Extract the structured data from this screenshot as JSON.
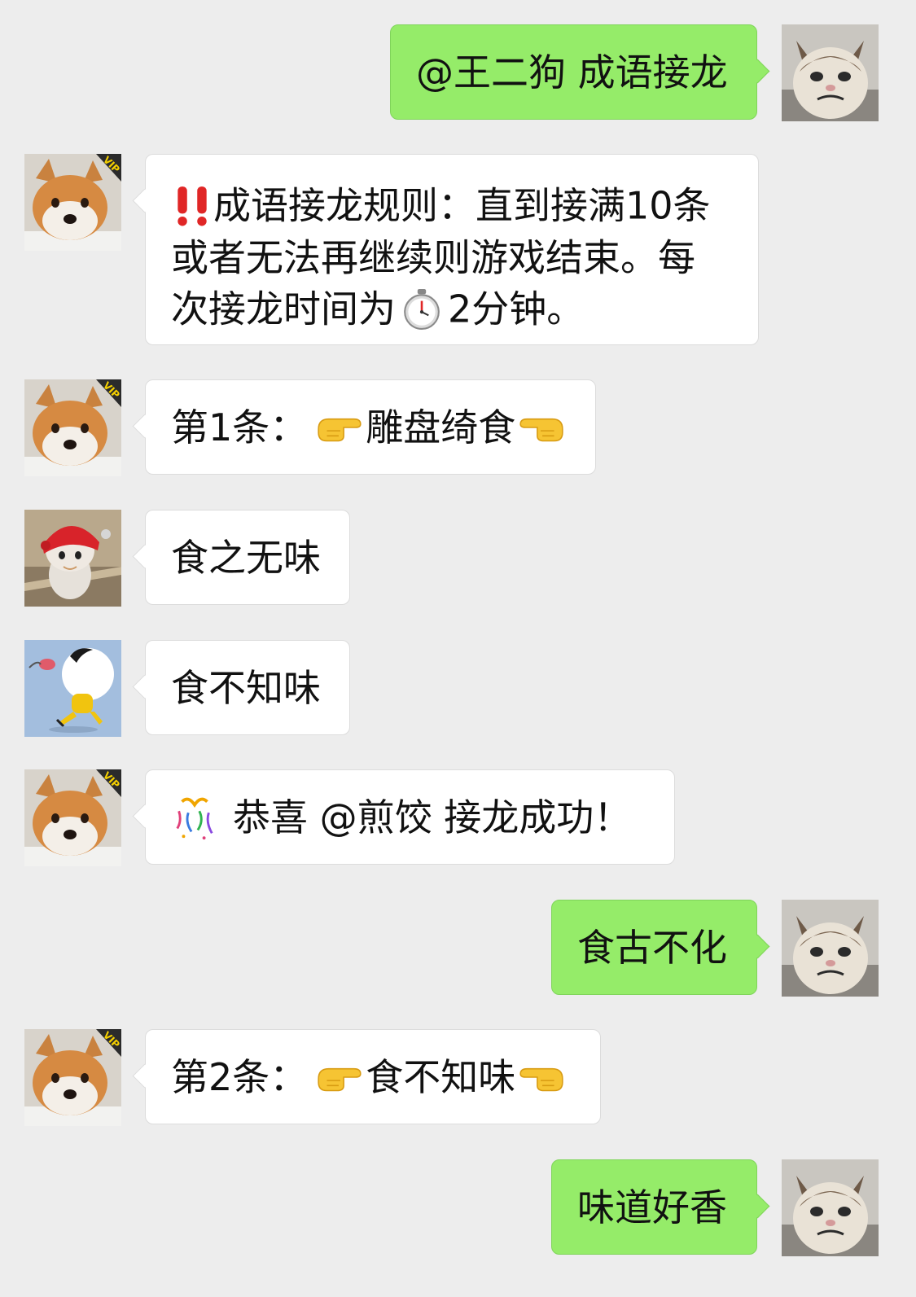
{
  "colors": {
    "background": "#ededed",
    "incoming_bubble": "#ffffff",
    "outgoing_bubble": "#95ec69"
  },
  "avatars": {
    "me": "grumpy-cat-avatar",
    "bot": "shiba-vip-avatar",
    "member_cat": "cat-red-hat-avatar",
    "member_cartoon": "cartoon-runner-avatar"
  },
  "messages": [
    {
      "sender": "me",
      "text": "@王二狗 成语接龙"
    },
    {
      "sender": "bot",
      "icon": "double-exclamation-icon",
      "lines": [
        "成语接龙规则：直到接满10条",
        "或者无法再继续则游戏结束。每",
        "次接龙时间为",
        "2分钟。"
      ],
      "inline_icon": "stopwatch-icon"
    },
    {
      "sender": "bot",
      "prefix": "第1条：",
      "left_icon": "pointing-right-icon",
      "text": "雕盘绮食",
      "right_icon": "pointing-left-icon"
    },
    {
      "sender": "member_cat",
      "text": "食之无味"
    },
    {
      "sender": "member_cartoon",
      "text": "食不知味"
    },
    {
      "sender": "bot",
      "icon": "confetti-icon",
      "text": "恭喜 @煎饺  接龙成功！"
    },
    {
      "sender": "me",
      "text": "食古不化"
    },
    {
      "sender": "bot",
      "prefix": "第2条：",
      "left_icon": "pointing-right-icon",
      "text": "食不知味",
      "right_icon": "pointing-left-icon"
    },
    {
      "sender": "me",
      "text": "味道好香"
    }
  ]
}
